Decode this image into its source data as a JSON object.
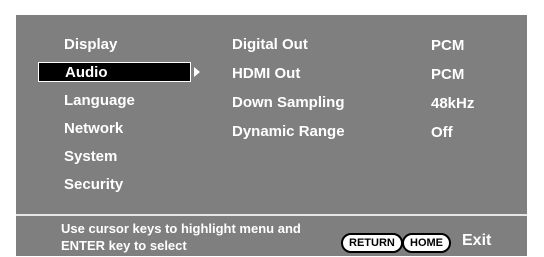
{
  "menu": {
    "items": [
      {
        "label": "Display"
      },
      {
        "label": "Audio",
        "selected": true
      },
      {
        "label": "Language"
      },
      {
        "label": "Network"
      },
      {
        "label": "System"
      },
      {
        "label": "Security"
      }
    ]
  },
  "settings": [
    {
      "label": "Digital Out",
      "value": "PCM"
    },
    {
      "label": "HDMI Out",
      "value": "PCM"
    },
    {
      "label": "Down Sampling",
      "value": "48kHz"
    },
    {
      "label": "Dynamic Range",
      "value": "Off"
    }
  ],
  "footer": {
    "hint_line1": "Use cursor keys to highlight menu and",
    "hint_line2": "ENTER key to select",
    "return_label": "RETURN",
    "home_label": "HOME",
    "exit_label": "Exit"
  },
  "colors": {
    "background": "#7f7f7f",
    "selection": "#000000",
    "text": "#ffffff"
  },
  "icons": {
    "selection_arrow": "triangle-right-icon"
  }
}
